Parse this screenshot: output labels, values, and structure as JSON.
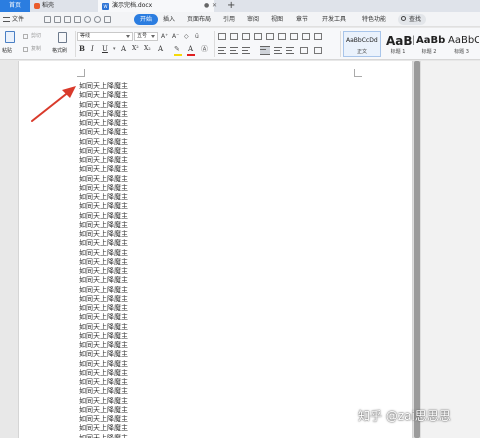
{
  "tabs": {
    "home": "首页",
    "daoke": "稻壳",
    "document": "演示完档.docx",
    "add": "+"
  },
  "menu": {
    "file": "文件",
    "items": [
      "开始",
      "插入",
      "页面布局",
      "引用",
      "审阅",
      "视图",
      "章节",
      "开发工具",
      "特色功能"
    ],
    "active": "开始",
    "search": "查找"
  },
  "ribbon": {
    "paste": "粘贴",
    "cut": "剪切",
    "copy": "复制",
    "format_painter": "格式刷",
    "font": "等线",
    "size": "五号",
    "styles": [
      {
        "sample": "AaBbCcDd",
        "name": "正文"
      },
      {
        "sample": "AaBl",
        "name": "标题 1"
      },
      {
        "sample": "AaBb(",
        "name": "标题 2"
      },
      {
        "sample": "AaBbC",
        "name": "标题 3"
      }
    ]
  },
  "document": {
    "lines": [
      "如同天上降魔主",
      "如同天上降魔主",
      "如同天上降魔主",
      "如同天上降魔主",
      "如同天上降魔主",
      "如同天上降魔主",
      "如同天上降魔主",
      "如同天上降魔主",
      "如同天上降魔主",
      "如同天上降魔主",
      "如同天上降魔主",
      "如同天上降魔主",
      "如同天上降魔主",
      "如同天上降魔主",
      "如同天上降魔主",
      "如同天上降魔主",
      "如同天上降魔主",
      "如同天上降魔主",
      "如同天上降魔主",
      "如同天上降魔主",
      "如同天上降魔主",
      "如同天上降魔主",
      "如同天上降魔主",
      "如同天上降魔主",
      "如同天上降魔主",
      "如同天上降魔主",
      "如同天上降魔主",
      "如同天上降魔主",
      "如同天上降魔主",
      "如同天上降魔主",
      "如同天上降魔主",
      "如同天上降魔主",
      "如同天上降魔主",
      "如同天上降魔主",
      "如同天上降魔主",
      "如同天上降魔主",
      "如同天上降魔主",
      "如同天上降魔主",
      "如同天上降魔主"
    ]
  },
  "colors": {
    "accent": "#2b7de0",
    "arrow": "#d93a2b"
  },
  "watermark": "知乎 @zai思思思"
}
